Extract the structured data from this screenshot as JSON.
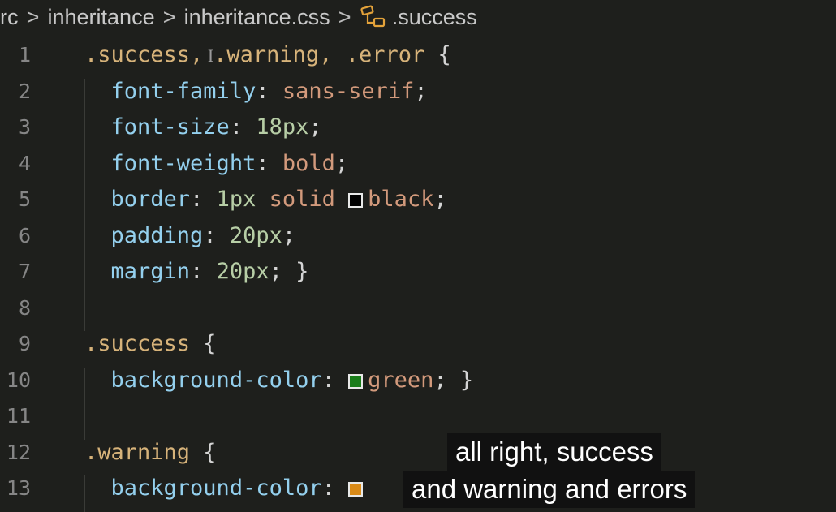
{
  "breadcrumb": {
    "items": [
      "rc",
      "inheritance",
      "inheritance.css",
      ".success"
    ],
    "separator": ">",
    "symbol_icon": "css-selector-icon"
  },
  "editor": {
    "lines": [
      {
        "n": "1",
        "tokens": [
          {
            "c": "sel",
            "t": ".success,"
          },
          {
            "c": "cursor",
            "t": " I"
          },
          {
            "c": "sel",
            "t": ".warning,"
          },
          {
            "c": "punc",
            "t": " "
          },
          {
            "c": "sel",
            "t": ".error"
          },
          {
            "c": "punc",
            "t": " {"
          }
        ]
      },
      {
        "n": "2",
        "tokens": [
          {
            "c": "ind",
            "t": "  "
          },
          {
            "c": "prop",
            "t": "font-family"
          },
          {
            "c": "punc",
            "t": ": "
          },
          {
            "c": "str",
            "t": "sans-serif"
          },
          {
            "c": "punc",
            "t": ";"
          }
        ]
      },
      {
        "n": "3",
        "tokens": [
          {
            "c": "ind",
            "t": "  "
          },
          {
            "c": "prop",
            "t": "font-size"
          },
          {
            "c": "punc",
            "t": ": "
          },
          {
            "c": "num",
            "t": "18px"
          },
          {
            "c": "punc",
            "t": ";"
          }
        ]
      },
      {
        "n": "4",
        "tokens": [
          {
            "c": "ind",
            "t": "  "
          },
          {
            "c": "prop",
            "t": "font-weight"
          },
          {
            "c": "punc",
            "t": ": "
          },
          {
            "c": "str",
            "t": "bold"
          },
          {
            "c": "punc",
            "t": ";"
          }
        ]
      },
      {
        "n": "5",
        "tokens": [
          {
            "c": "ind",
            "t": "  "
          },
          {
            "c": "prop",
            "t": "border"
          },
          {
            "c": "punc",
            "t": ": "
          },
          {
            "c": "num",
            "t": "1px"
          },
          {
            "c": "punc",
            "t": " "
          },
          {
            "c": "str",
            "t": "solid"
          },
          {
            "c": "punc",
            "t": " "
          },
          {
            "c": "swatch",
            "t": "#000000"
          },
          {
            "c": "str",
            "t": "black"
          },
          {
            "c": "punc",
            "t": ";"
          }
        ]
      },
      {
        "n": "6",
        "tokens": [
          {
            "c": "ind",
            "t": "  "
          },
          {
            "c": "prop",
            "t": "padding"
          },
          {
            "c": "punc",
            "t": ": "
          },
          {
            "c": "num",
            "t": "20px"
          },
          {
            "c": "punc",
            "t": ";"
          }
        ]
      },
      {
        "n": "7",
        "tokens": [
          {
            "c": "ind",
            "t": "  "
          },
          {
            "c": "prop",
            "t": "margin"
          },
          {
            "c": "punc",
            "t": ": "
          },
          {
            "c": "num",
            "t": "20px"
          },
          {
            "c": "punc",
            "t": "; }"
          }
        ]
      },
      {
        "n": "8",
        "tokens": []
      },
      {
        "n": "9",
        "tokens": [
          {
            "c": "sel",
            "t": ".success"
          },
          {
            "c": "punc",
            "t": " {"
          }
        ]
      },
      {
        "n": "10",
        "tokens": [
          {
            "c": "ind",
            "t": "  "
          },
          {
            "c": "prop",
            "t": "background-color"
          },
          {
            "c": "punc",
            "t": ": "
          },
          {
            "c": "swatch",
            "t": "#1a7d1a"
          },
          {
            "c": "str",
            "t": "green"
          },
          {
            "c": "punc",
            "t": "; }"
          }
        ]
      },
      {
        "n": "11",
        "tokens": []
      },
      {
        "n": "12",
        "tokens": [
          {
            "c": "sel",
            "t": ".warning"
          },
          {
            "c": "punc",
            "t": " {"
          }
        ]
      },
      {
        "n": "13",
        "tokens": [
          {
            "c": "ind",
            "t": "  "
          },
          {
            "c": "prop",
            "t": "background-color"
          },
          {
            "c": "punc",
            "t": ": "
          },
          {
            "c": "swatch",
            "t": "#d98a17"
          }
        ]
      }
    ]
  },
  "subtitle": {
    "lines": [
      "all right, success",
      "and warning and errors"
    ]
  },
  "colors": {
    "background": "#1e1f1c",
    "selector": "#d7b37a",
    "property": "#94d0ee",
    "string": "#d39a7c",
    "number": "#b7cea6"
  }
}
